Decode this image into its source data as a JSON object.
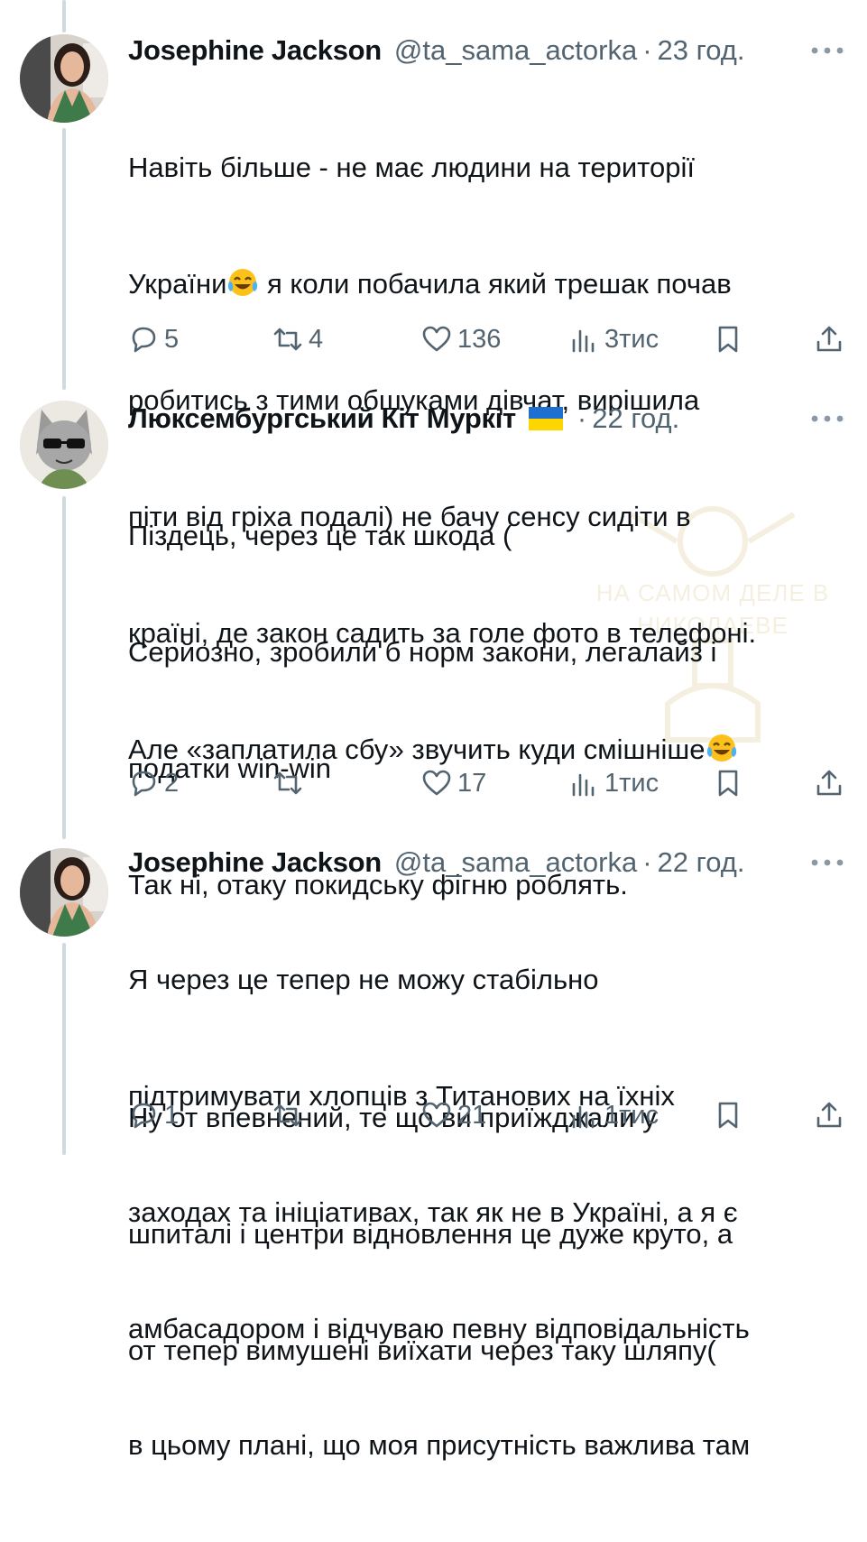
{
  "tweets": [
    {
      "author": "Josephine Jackson",
      "handle": "@ta_sama_actorka",
      "separator": "·",
      "time": "23 год.",
      "text_lines": [
        "Навіть більше - не має людини на території",
        "України",
        " я коли побачила який трешак почав",
        "робитись з тими обшуками дівчат, вирішила",
        "піти від гріха подалі) не бачу сенсу сидіти в",
        "країні, де закон садить за голе фото в телефоні.",
        "Але «заплатила сбу» звучить куди смішніше"
      ],
      "emoji": "face-with-tears-of-joy",
      "replies": "5",
      "reposts": "4",
      "likes": "136",
      "views": "3тис"
    },
    {
      "author": "Люксембургський Кіт Муркіт",
      "flag": "ukraine-flag",
      "separator": "·",
      "time": "22 год.",
      "text_lines": [
        "Піздець, через це так шкода (",
        "Серйозно, зробили б норм закони, легалайз і",
        "податки win-win",
        "Так ні, отаку покидську фігню роблять.",
        "",
        "Ну от впевнений, те що ви приїжджали у",
        "шпиталі і центри відновлення це дуже круто, а",
        "от тепер вимушені виїхати через таку шляпу("
      ],
      "replies": "2",
      "reposts": "",
      "likes": "17",
      "views": "1тис"
    },
    {
      "author": "Josephine Jackson",
      "handle": "@ta_sama_actorka",
      "separator": "·",
      "time": "22 год.",
      "text_lines": [
        "Я через це тепер не можу стабільно",
        "підтримувати хлопців з Титанових на їхніх",
        "заходах та ініціативах, так як не в Україні, а я є",
        "амбасадором і відчуваю певну відповідальність",
        "в цьому плані, що моя присутність важлива там"
      ],
      "replies": "1",
      "reposts": "",
      "likes": "21",
      "views": "1тис"
    }
  ],
  "watermark": {
    "line1": "НА САМОМ ДЕЛЕ В",
    "line2": "НИКОЛАЕВЕ"
  },
  "colors": {
    "text": "#0f1419",
    "muted": "#536471",
    "thread_line": "#cfd9de",
    "flag_blue": "#1f6fd1",
    "flag_yellow": "#ffd500"
  }
}
